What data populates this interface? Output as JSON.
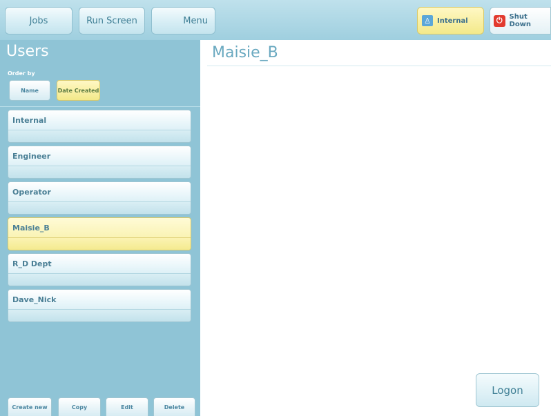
{
  "topbar": {
    "jobs_label": "Jobs",
    "run_screen_label": "Run Screen",
    "menu_label": "Menu",
    "current_user_label": "Internal",
    "shutdown_label": "Shut Down"
  },
  "users_panel": {
    "title": "Users",
    "order_by_label": "Order by",
    "sort_name_label": "Name",
    "sort_date_label": "Date Created",
    "active_sort": "Date Created",
    "items": [
      {
        "label": "Internal",
        "selected": false
      },
      {
        "label": "Engineer",
        "selected": false
      },
      {
        "label": "Operator",
        "selected": false
      },
      {
        "label": "Maisie_B",
        "selected": true
      },
      {
        "label": "R_D Dept",
        "selected": false
      },
      {
        "label": "Dave_Nick",
        "selected": false
      }
    ],
    "create_label": "Create new",
    "copy_label": "Copy",
    "edit_label": "Edit",
    "delete_label": "Delete"
  },
  "detail": {
    "title": "Maisie_B",
    "logon_label": "Logon"
  },
  "colors": {
    "panel_bg": "#8fc4d6",
    "selected_yellow": "#f3e98a",
    "accent_blue": "#6aa9c0",
    "shutdown_red": "#e23a2e"
  },
  "icons": {
    "user": "user-icon",
    "power": "power-icon"
  }
}
